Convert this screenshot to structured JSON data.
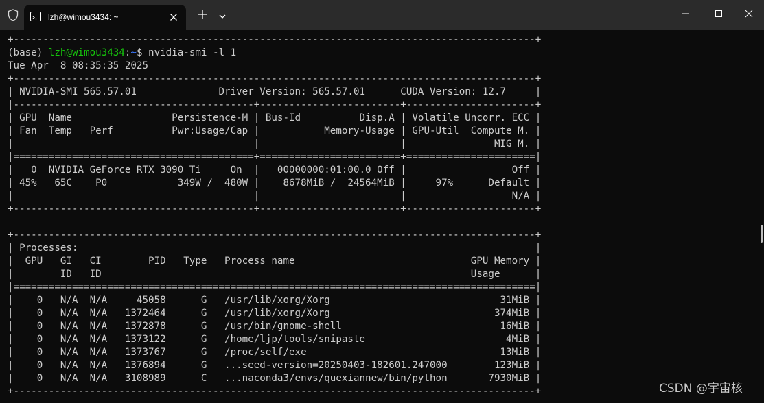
{
  "window": {
    "tab_title": "lzh@wimou3434: ~",
    "icons": {
      "shield": "shield-icon",
      "tab": "terminal-icon",
      "close_tab": "close-icon",
      "new_tab": "plus-icon",
      "dropdown": "chevron-down-icon",
      "minimize": "minimize-icon",
      "maximize": "maximize-icon",
      "close_window": "close-icon"
    }
  },
  "terminal": {
    "prompt": {
      "env": "(base) ",
      "user_host": "lzh@wimou3434",
      "colon": ":",
      "dir": "~",
      "dollar": "$ ",
      "command": "nvidia-smi -l 1"
    },
    "lines": [
      "+-----------------------------------------------------------------------------------------+",
      null,
      "Tue Apr  8 08:35:35 2025",
      "+-----------------------------------------------------------------------------------------+",
      "| NVIDIA-SMI 565.57.01              Driver Version: 565.57.01      CUDA Version: 12.7     |",
      "|-----------------------------------------+------------------------+----------------------+",
      "| GPU  Name                 Persistence-M | Bus-Id          Disp.A | Volatile Uncorr. ECC |",
      "| Fan  Temp   Perf          Pwr:Usage/Cap |           Memory-Usage | GPU-Util  Compute M. |",
      "|                                         |                        |               MIG M. |",
      "|=========================================+========================+======================|",
      "|   0  NVIDIA GeForce RTX 3090 Ti     On  |   00000000:01:00.0 Off |                  Off |",
      "| 45%   65C    P0            349W /  480W |    8678MiB /  24564MiB |     97%      Default |",
      "|                                         |                        |                  N/A |",
      "+-----------------------------------------+------------------------+----------------------+",
      "",
      "+-----------------------------------------------------------------------------------------+",
      "| Processes:                                                                              |",
      "|  GPU   GI   CI        PID   Type   Process name                              GPU Memory |",
      "|        ID   ID                                                               Usage      |",
      "|=========================================================================================|",
      "|    0   N/A  N/A     45058      G   /usr/lib/xorg/Xorg                             31MiB |",
      "|    0   N/A  N/A   1372464      G   /usr/lib/xorg/Xorg                            374MiB |",
      "|    0   N/A  N/A   1372878      G   /usr/bin/gnome-shell                           16MiB |",
      "|    0   N/A  N/A   1373122      G   /home/ljp/tools/snipaste                        4MiB |",
      "|    0   N/A  N/A   1373767      G   /proc/self/exe                                 13MiB |",
      "|    0   N/A  N/A   1376894      G   ...seed-version=20250403-182601.247000        123MiB |",
      "|    0   N/A  N/A   3108989      C   ...naconda3/envs/quexiannew/bin/python       7930MiB |",
      "+-----------------------------------------------------------------------------------------+"
    ]
  },
  "watermark": "CSDN @宇宙核",
  "colors": {
    "background": "#0c0c0c",
    "titlebar": "#2b2b2b",
    "text": "#cccccc",
    "prompt_user": "#16c60c",
    "prompt_dir": "#3b78ff"
  }
}
